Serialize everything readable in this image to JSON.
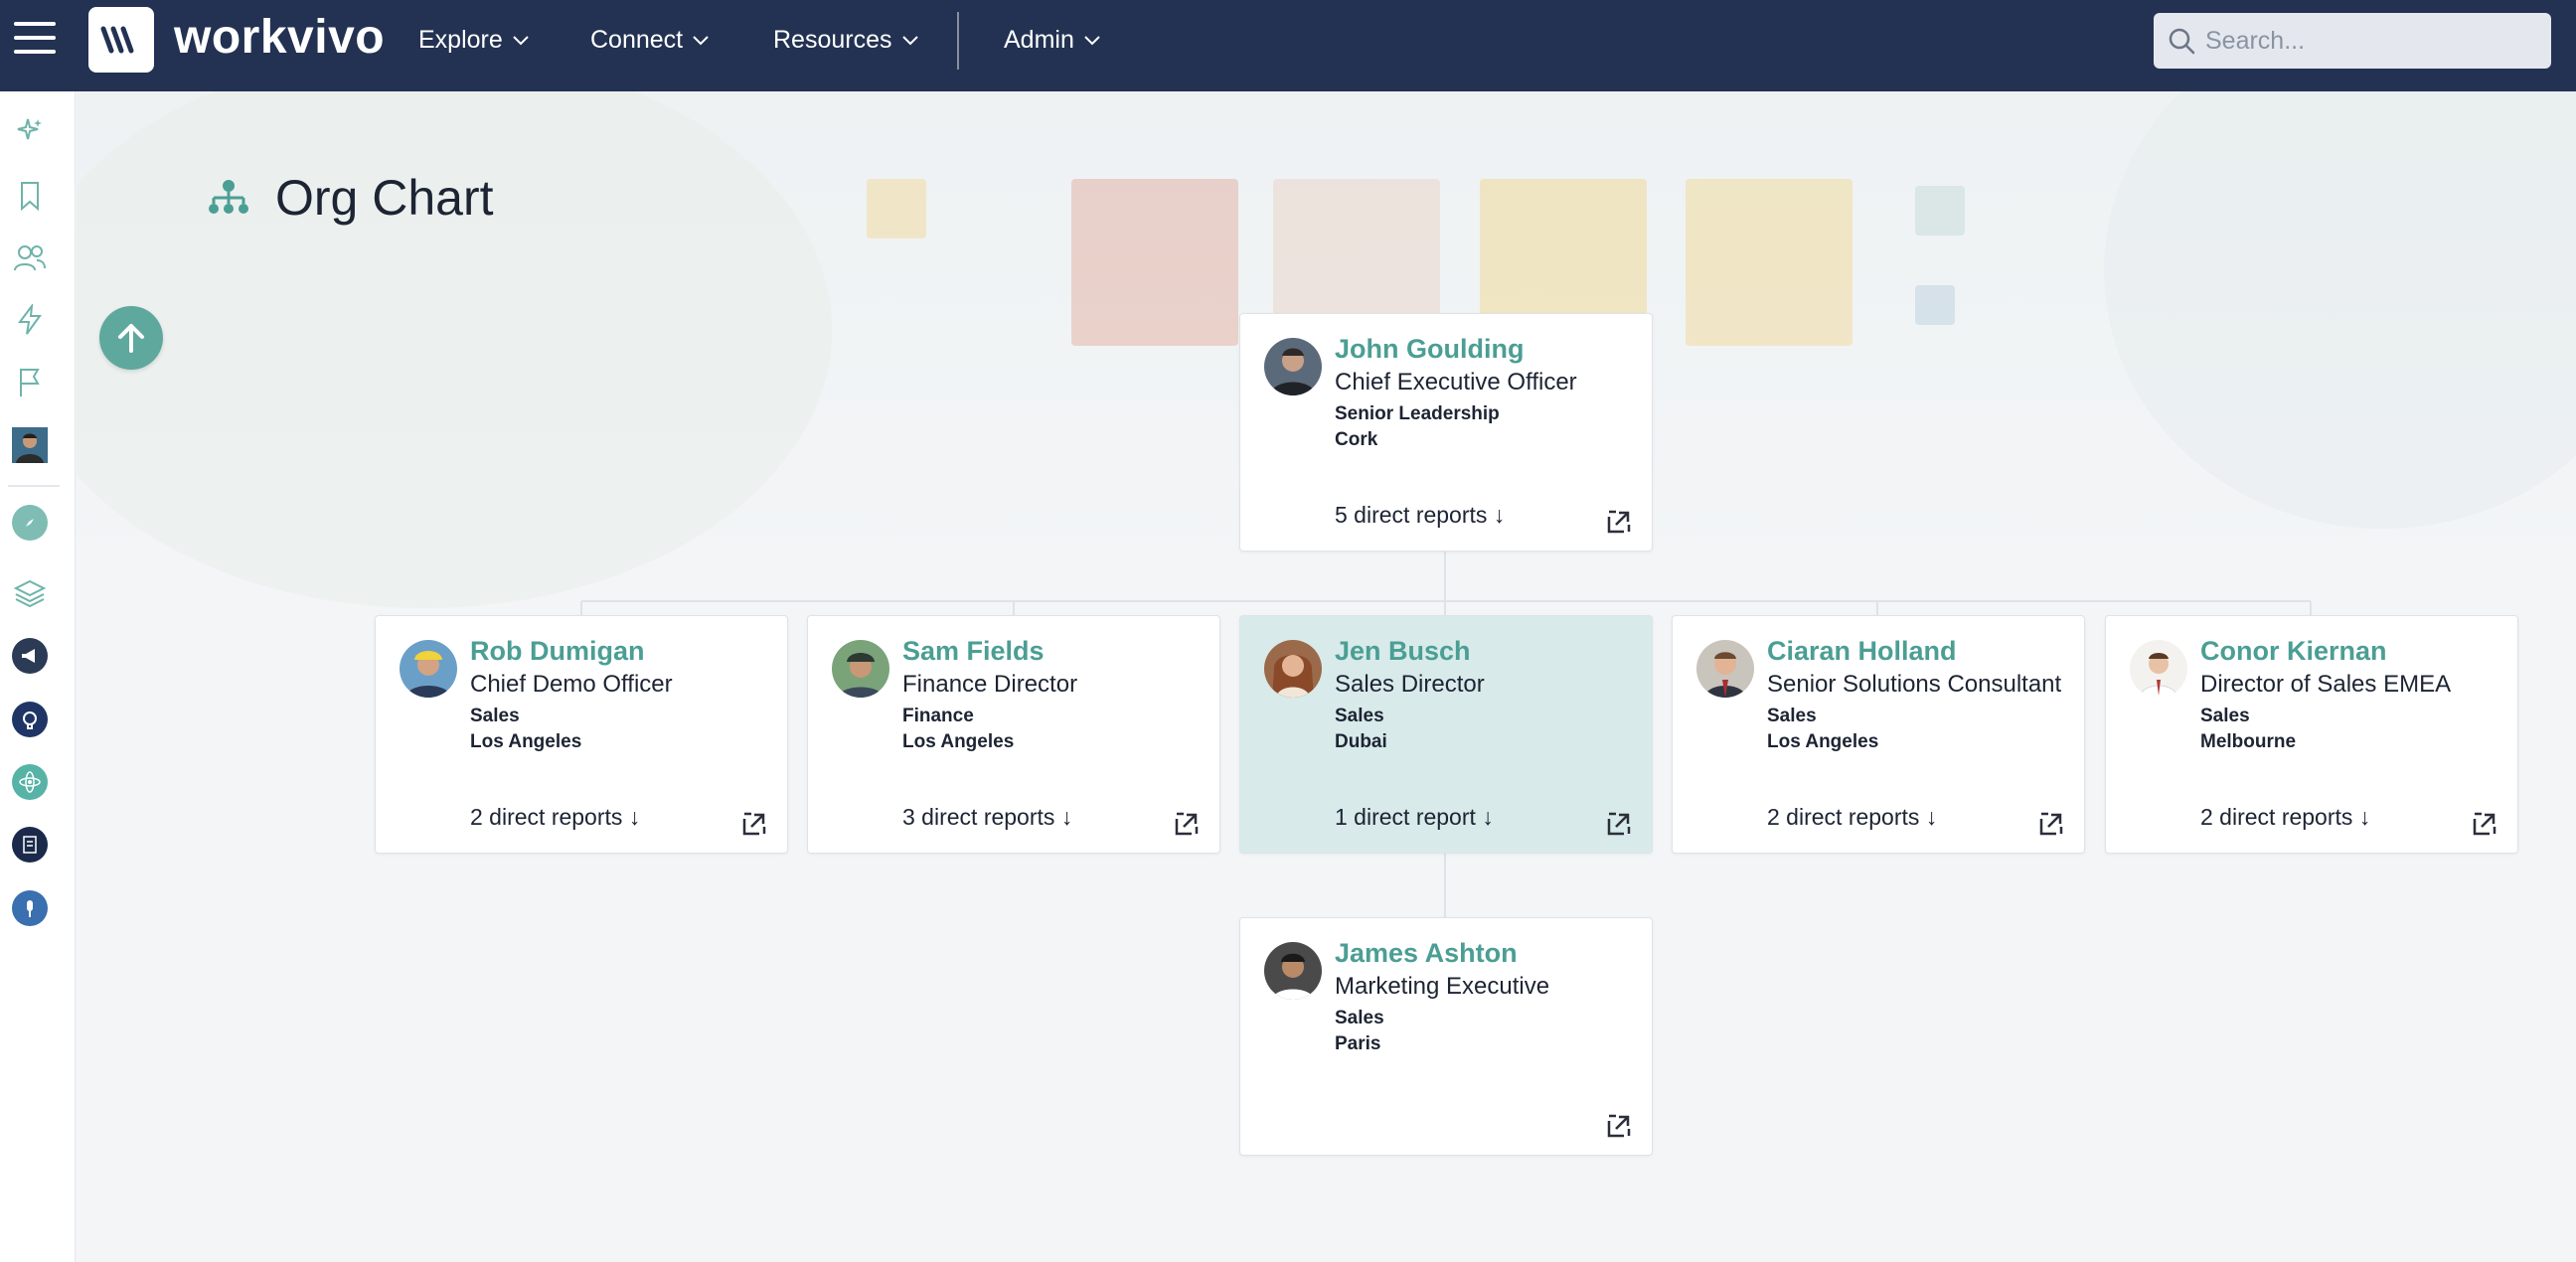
{
  "brand": {
    "name": "workvivo"
  },
  "nav": {
    "items": [
      {
        "label": "Explore"
      },
      {
        "label": "Connect"
      },
      {
        "label": "Resources"
      },
      {
        "label": "Admin"
      }
    ]
  },
  "search": {
    "placeholder": "Search..."
  },
  "page": {
    "title": "Org Chart"
  },
  "colors": {
    "topbar": "#233252",
    "accent": "#4b9e94",
    "highlight_card": "#d8eaea",
    "up_button": "#5fa89e"
  },
  "people": [
    {
      "name": "John Goulding",
      "role": "Chief Executive Officer",
      "department": "Senior Leadership",
      "location": "Cork",
      "reports": "5 direct reports ↓"
    },
    {
      "name": "Rob Dumigan",
      "role": "Chief Demo Officer",
      "department": "Sales",
      "location": "Los Angeles",
      "reports": "2 direct reports ↓"
    },
    {
      "name": "Sam Fields",
      "role": "Finance Director",
      "department": "Finance",
      "location": "Los Angeles",
      "reports": "3 direct reports ↓"
    },
    {
      "name": "Jen Busch",
      "role": "Sales Director",
      "department": "Sales",
      "location": "Dubai",
      "reports": "1 direct report ↓"
    },
    {
      "name": "Ciaran Holland",
      "role": "Senior Solutions Consultant",
      "department": "Sales",
      "location": "Los Angeles",
      "reports": "2 direct reports ↓"
    },
    {
      "name": "Conor Kiernan",
      "role": "Director of Sales EMEA",
      "department": "Sales",
      "location": "Melbourne",
      "reports": "2 direct reports ↓"
    },
    {
      "name": "James Ashton",
      "role": "Marketing Executive",
      "department": "Sales",
      "location": "Paris",
      "reports": ""
    }
  ]
}
